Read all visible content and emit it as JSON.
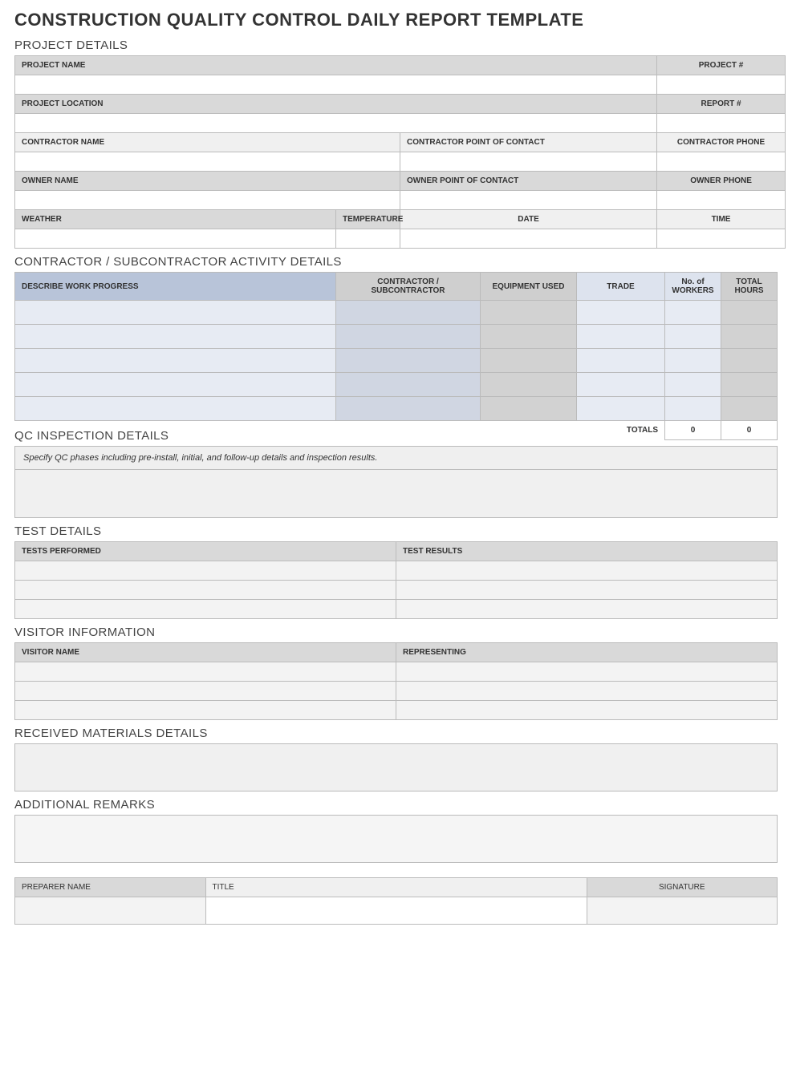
{
  "title": "CONSTRUCTION QUALITY CONTROL DAILY REPORT TEMPLATE",
  "sections": {
    "project_details": "PROJECT DETAILS",
    "activity": "CONTRACTOR / SUBCONTRACTOR ACTIVITY DETAILS",
    "qc": "QC INSPECTION DETAILS",
    "test": "TEST DETAILS",
    "visitor": "VISITOR INFORMATION",
    "materials": "RECEIVED MATERIALS DETAILS",
    "remarks": "ADDITIONAL REMARKS"
  },
  "project": {
    "name_label": "PROJECT NAME",
    "name_value": "",
    "number_label": "PROJECT #",
    "number_value": "",
    "location_label": "PROJECT LOCATION",
    "location_value": "",
    "report_label": "REPORT #",
    "report_value": "",
    "contractor_name_label": "CONTRACTOR NAME",
    "contractor_name_value": "",
    "contractor_poc_label": "CONTRACTOR POINT OF CONTACT",
    "contractor_poc_value": "",
    "contractor_phone_label": "CONTRACTOR PHONE",
    "contractor_phone_value": "",
    "owner_name_label": "OWNER NAME",
    "owner_name_value": "",
    "owner_poc_label": "OWNER POINT OF CONTACT",
    "owner_poc_value": "",
    "owner_phone_label": "OWNER PHONE",
    "owner_phone_value": "",
    "weather_label": "WEATHER",
    "weather_value": "",
    "temperature_label": "TEMPERATURE",
    "temperature_value": "",
    "date_label": "DATE",
    "date_value": "",
    "time_label": "TIME",
    "time_value": ""
  },
  "activity": {
    "headers": {
      "progress": "DESCRIBE WORK PROGRESS",
      "contractor": "CONTRACTOR / SUBCONTRACTOR",
      "equipment": "EQUIPMENT USED",
      "trade": "TRADE",
      "workers": "No. of WORKERS",
      "hours": "TOTAL HOURS"
    },
    "rows": [
      {
        "progress": "",
        "contractor": "",
        "equipment": "",
        "trade": "",
        "workers": "",
        "hours": ""
      },
      {
        "progress": "",
        "contractor": "",
        "equipment": "",
        "trade": "",
        "workers": "",
        "hours": ""
      },
      {
        "progress": "",
        "contractor": "",
        "equipment": "",
        "trade": "",
        "workers": "",
        "hours": ""
      },
      {
        "progress": "",
        "contractor": "",
        "equipment": "",
        "trade": "",
        "workers": "",
        "hours": ""
      },
      {
        "progress": "",
        "contractor": "",
        "equipment": "",
        "trade": "",
        "workers": "",
        "hours": ""
      }
    ],
    "totals_label": "TOTALS",
    "totals_workers": "0",
    "totals_hours": "0"
  },
  "qc": {
    "note": "Specify QC phases including pre-install, initial, and follow-up details and inspection results.",
    "body": ""
  },
  "test": {
    "headers": {
      "performed": "TESTS PERFORMED",
      "results": "TEST RESULTS"
    },
    "rows": [
      {
        "performed": "",
        "results": ""
      },
      {
        "performed": "",
        "results": ""
      },
      {
        "performed": "",
        "results": ""
      }
    ]
  },
  "visitor": {
    "headers": {
      "name": "VISITOR NAME",
      "rep": "REPRESENTING"
    },
    "rows": [
      {
        "name": "",
        "rep": ""
      },
      {
        "name": "",
        "rep": ""
      },
      {
        "name": "",
        "rep": ""
      }
    ]
  },
  "materials": {
    "body": ""
  },
  "remarks": {
    "body": ""
  },
  "signoff": {
    "preparer_label": "PREPARER NAME",
    "preparer_value": "",
    "title_label": "TITLE",
    "title_value": "",
    "signature_label": "SIGNATURE",
    "signature_value": ""
  }
}
